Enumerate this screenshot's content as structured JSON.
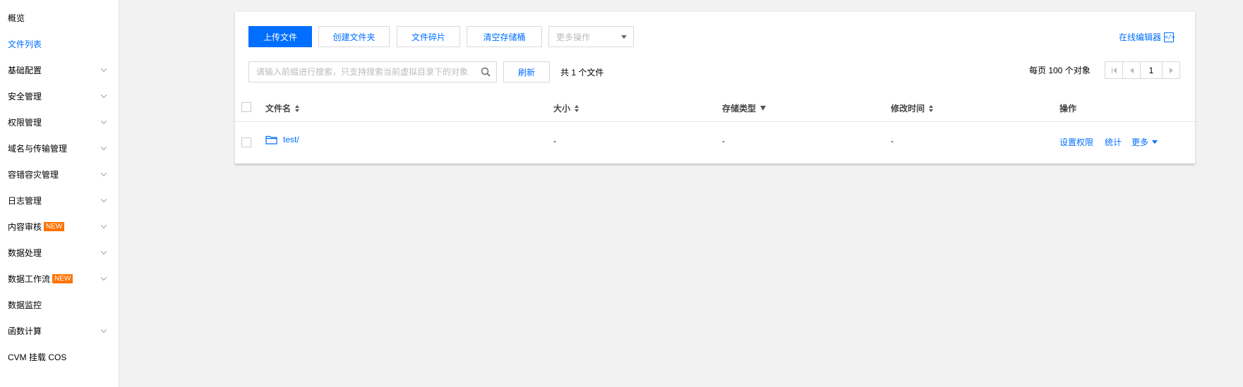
{
  "sidebar": {
    "items": [
      {
        "label": "概览",
        "active": false,
        "expandable": false,
        "badge": ""
      },
      {
        "label": "文件列表",
        "active": true,
        "expandable": false,
        "badge": ""
      },
      {
        "label": "基础配置",
        "active": false,
        "expandable": true,
        "badge": ""
      },
      {
        "label": "安全管理",
        "active": false,
        "expandable": true,
        "badge": ""
      },
      {
        "label": "权限管理",
        "active": false,
        "expandable": true,
        "badge": ""
      },
      {
        "label": "域名与传输管理",
        "active": false,
        "expandable": true,
        "badge": ""
      },
      {
        "label": "容错容灾管理",
        "active": false,
        "expandable": true,
        "badge": ""
      },
      {
        "label": "日志管理",
        "active": false,
        "expandable": true,
        "badge": ""
      },
      {
        "label": "内容审核",
        "active": false,
        "expandable": true,
        "badge": "NEW"
      },
      {
        "label": "数据处理",
        "active": false,
        "expandable": true,
        "badge": ""
      },
      {
        "label": "数据工作流",
        "active": false,
        "expandable": true,
        "badge": "NEW"
      },
      {
        "label": "数据监控",
        "active": false,
        "expandable": false,
        "badge": ""
      },
      {
        "label": "函数计算",
        "active": false,
        "expandable": true,
        "badge": ""
      },
      {
        "label": "CVM 挂载 COS",
        "active": false,
        "expandable": false,
        "badge": ""
      }
    ]
  },
  "toolbar": {
    "upload_label": "上传文件",
    "create_folder_label": "创建文件夹",
    "fragments_label": "文件碎片",
    "clear_bucket_label": "清空存储桶",
    "more_actions_placeholder": "更多操作",
    "online_editor_label": "在线编辑器"
  },
  "search": {
    "placeholder": "请输入前缀进行搜索，只支持搜索当前虚拟目录下的对象",
    "value": ""
  },
  "refresh_label": "刷新",
  "file_count_text": "共 1 个文件",
  "pagination": {
    "per_page_text": "每页 100 个对象",
    "current_page": "1"
  },
  "table": {
    "headers": {
      "name": "文件名",
      "size": "大小",
      "storage_class": "存储类型",
      "modified": "修改时间",
      "actions": "操作"
    },
    "rows": [
      {
        "name": "test/",
        "size": "-",
        "storage_class": "-",
        "modified": "-",
        "actions": {
          "permissions": "设置权限",
          "stats": "统计",
          "more": "更多"
        }
      }
    ]
  },
  "colors": {
    "accent": "#006eff",
    "badge": "#ff7200",
    "background": "#f2f2f2"
  }
}
